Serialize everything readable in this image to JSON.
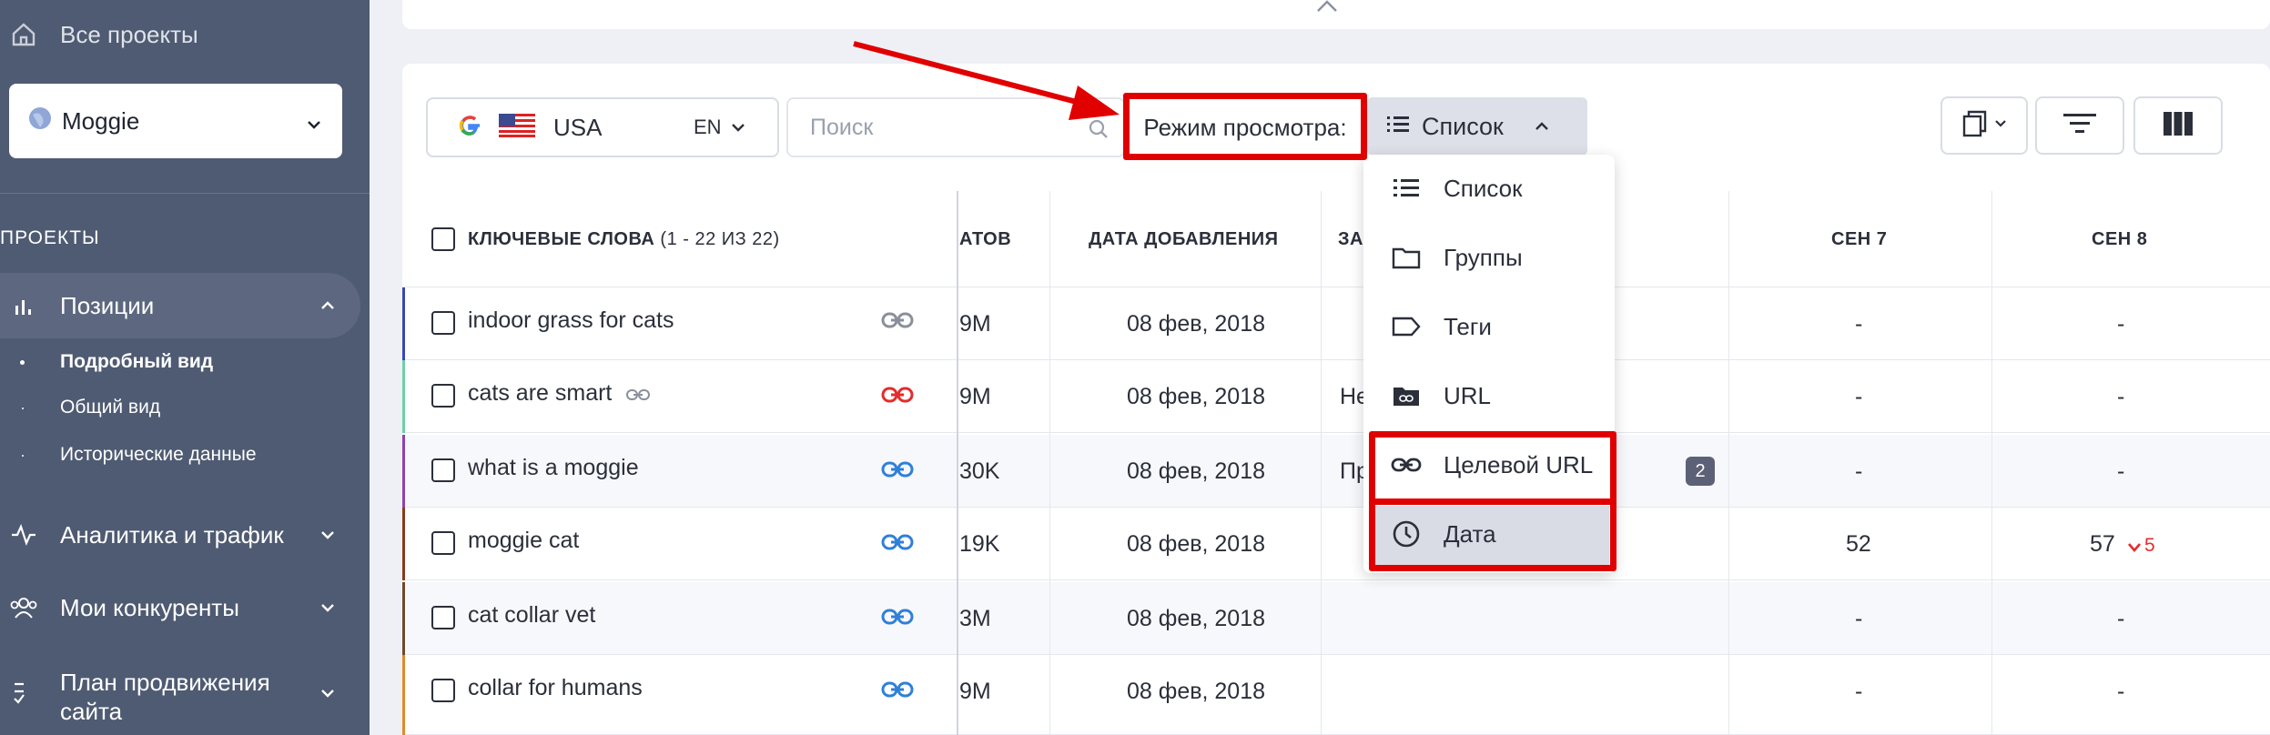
{
  "sidebar": {
    "all_projects": "Все проекты",
    "project_name": "Moggie",
    "section_label": "ПРОЕКТЫ",
    "positions": "Позиции",
    "sub_items": [
      "Подробный вид",
      "Общий вид",
      "Исторические данные"
    ],
    "analytics": "Аналитика и трафик",
    "competitors": "Мои конкуренты",
    "plan_line1": "План продвижения",
    "plan_line2": "сайта"
  },
  "toolbar": {
    "country": "USA",
    "language": "EN",
    "search_placeholder": "Поиск",
    "view_mode_label": "Режим просмотра:",
    "view_mode_value": "Список"
  },
  "table": {
    "headers": {
      "keywords": "КЛЮЧЕВЫЕ СЛОВА",
      "keywords_count": "(1 - 22 ИЗ 22)",
      "results_partial": "АТОВ",
      "date_added": "ДАТА ДОБАВЛЕНИЯ",
      "col_partial": "ЗА",
      "sep7": "СЕН 7",
      "sep8": "СЕН 8"
    },
    "rows": [
      {
        "keyword": "indoor grass for cats",
        "results": "9M",
        "date": "08 фев, 2018",
        "extra": "",
        "sep7": "-",
        "sep8": "-",
        "change": ""
      },
      {
        "keyword": "cats are smart",
        "results": "9M",
        "date": "08 фев, 2018",
        "extra": "Не",
        "sep7": "-",
        "sep8": "-",
        "change": ""
      },
      {
        "keyword": "what is a moggie",
        "results": "30K",
        "date": "08 фев, 2018",
        "extra": "Пр",
        "sep7": "-",
        "sep8": "-",
        "change": ""
      },
      {
        "keyword": "moggie cat",
        "results": "19K",
        "date": "08 фев, 2018",
        "extra": "",
        "sep7": "52",
        "sep8": "57",
        "change": "5"
      },
      {
        "keyword": "cat collar vet",
        "results": "3M",
        "date": "08 фев, 2018",
        "extra": "",
        "sep7": "-",
        "sep8": "-",
        "change": ""
      },
      {
        "keyword": "collar for humans",
        "results": "9M",
        "date": "08 фев, 2018",
        "extra": "",
        "sep7": "-",
        "sep8": "-",
        "change": ""
      }
    ]
  },
  "menu": {
    "items": [
      "Список",
      "Группы",
      "Теги",
      "URL",
      "Целевой URL",
      "Дата"
    ]
  },
  "badge": "2",
  "colors": {
    "accent_red": "#e10000",
    "link_blue": "#2f80d8",
    "link_red": "#e52b2b",
    "sidebar": "#4f5b72"
  }
}
